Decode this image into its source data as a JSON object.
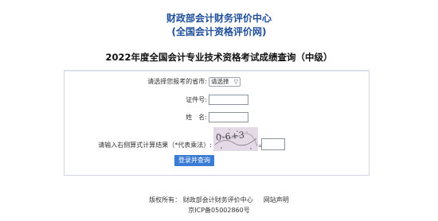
{
  "header": {
    "org_name": "财政部会计财务评价中心",
    "org_site": "(全国会计资格评价网)",
    "query_title": "2022年度全国会计专业技术资格考试成绩查询（中级）"
  },
  "form": {
    "province_label": "请选择您报考的省市:",
    "province_select_value": "请选择",
    "id_label": "证件号:",
    "id_value": "",
    "name_label": "姓　名:",
    "name_value": "",
    "captcha_label": "请输入右侧算式计算结果（*代表乘法）:",
    "captcha_text": "0-6+3",
    "captcha_suffix": "=",
    "captcha_answer": "",
    "submit_label": "登录并查询"
  },
  "footer": {
    "copyright_label": "版权所有：",
    "copyright_org": "财政部会计财务评价中心",
    "site_statement": "网站声明",
    "icp": "京ICP备05002860号"
  },
  "colors": {
    "title_blue": "#1f4f9a",
    "button_blue": "#3a7bd5",
    "captcha_bg": "#e4d9e6",
    "box_border": "#cfd6e2"
  },
  "icons": {
    "select_caret": "chevron-down-icon"
  }
}
